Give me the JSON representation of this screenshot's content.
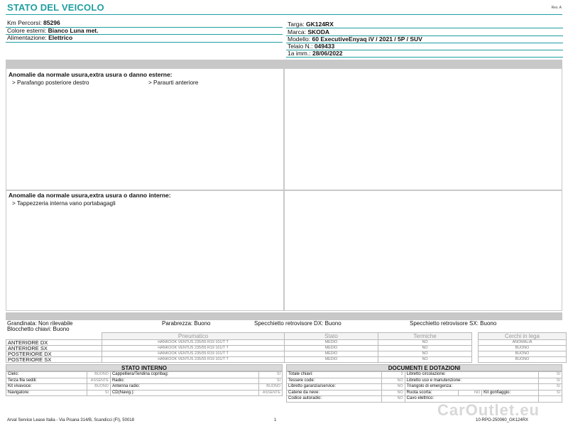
{
  "header": {
    "title": "STATO DEL VEICOLO",
    "rev": "Rev. A"
  },
  "vehicle_left": [
    {
      "label": "Km Percorsi:",
      "value": "85296"
    },
    {
      "label": "Colore esterni:",
      "value": "Bianco Luna met."
    },
    {
      "label": "Alimentazione:",
      "value": "Elettrico"
    }
  ],
  "vehicle_right": [
    {
      "label": "Targa:",
      "value": "GK124RX"
    },
    {
      "label": "Marca:",
      "value": "SKODA"
    },
    {
      "label": "Modello:",
      "value": "60 ExecutiveEnyaq iV / 2021 / 5P / SUV"
    },
    {
      "label": "Telaio N.:",
      "value": "049433"
    },
    {
      "label": "1a imm.:",
      "value": "28/06/2022"
    }
  ],
  "external": {
    "title": "Anomalie da normale usura,extra usura o danno esterne:",
    "items": [
      "> Parafango posteriore destro",
      "> Paraurti anteriore"
    ]
  },
  "internal": {
    "title": "Anomalie da normale usura,extra usura o danno interne:",
    "items": [
      "> Tappezzeria interna vano portabagagli"
    ]
  },
  "conditions": {
    "grandinata": "Grandinata: Non rilevabile",
    "parabrezza": "Parabrezza: Buono",
    "specchietto_dx": "Specchietto retrovisore DX: Buono",
    "specchietto_sx": "Specchietto retrovisore SX: Buono",
    "blocchetto": "Blocchetto chiavi: Buono"
  },
  "tyres": {
    "headers": {
      "pneumatico": "Pneumatico",
      "stato": "Stato",
      "termiche": "Termiche",
      "cerchi": "Cerchi in lega"
    },
    "rows": [
      {
        "pos": "ANTERIORE DX",
        "model": "HANKOOK VENTUS 235/55 R19 101/T T",
        "stato": "MEDIO",
        "termiche": "NO",
        "cerchi": "ANOMALIA"
      },
      {
        "pos": "ANTERIORE SX",
        "model": "HANKOOK VENTUS 235/55 R19 101/T T",
        "stato": "MEDIO",
        "termiche": "NO",
        "cerchi": "BUONO"
      },
      {
        "pos": "POSTERIORE DX",
        "model": "HANKOOK VENTUS 235/55 R19 101/T T",
        "stato": "MEDIO",
        "termiche": "NO",
        "cerchi": "BUONO"
      },
      {
        "pos": "POSTERIORE SX",
        "model": "HANKOOK VENTUS 235/55 R19 101/T T",
        "stato": "MEDIO",
        "termiche": "NO",
        "cerchi": "BUONO"
      }
    ]
  },
  "interno": {
    "title": "STATO INTERNO",
    "rows": [
      [
        {
          "k": "Cielo:",
          "v": "BUONO"
        },
        {
          "k": "Cappelliera/Tendina copribag:",
          "v": "SI"
        }
      ],
      [
        {
          "k": "Terza fila sedili:",
          "v": "ASSENTE"
        },
        {
          "k": "Radio:",
          "v": "SI"
        }
      ],
      [
        {
          "k": "Kit vivavoce:",
          "v": "BUONO"
        },
        {
          "k": "Antenna radio:",
          "v": "BUONO"
        }
      ],
      [
        {
          "k": "Navigatore:",
          "v": "SI"
        },
        {
          "k": "CD(Navig.):",
          "v": "ASSENTE"
        }
      ]
    ]
  },
  "documenti": {
    "title": "DOCUMENTI E DOTAZIONI",
    "left": [
      {
        "k": "Totale chiavi:",
        "v": "2"
      },
      {
        "k": "Tessere code:",
        "v": "NO"
      },
      {
        "k": "Libretto garanzia/service:",
        "v": "NO"
      },
      {
        "k": "Catene da neve:",
        "v": "NO"
      },
      {
        "k": "Codice autoradio:",
        "v": "NO"
      }
    ],
    "right": [
      {
        "k": "Libretto circolazione:",
        "v": "SI"
      },
      {
        "k": "Libretto uso e manutenzione:",
        "v": "SI"
      },
      {
        "k": "Triangolo di emergenza:",
        "v": "SI"
      },
      {
        "k": "Ruota scorta:",
        "v": "NO",
        "k2": "Kit gonfiaggio:",
        "v2": "SI"
      },
      {
        "k": "Cavo elettrico:",
        "v": ""
      }
    ]
  },
  "footer": {
    "company": "Arval Service Lease Italia - Via Pisana 314/B, Scandicci (FI), 50018",
    "page": "1",
    "doc": "10-RPO-250060_GK124RX"
  },
  "watermark": "CarOutlet.eu"
}
